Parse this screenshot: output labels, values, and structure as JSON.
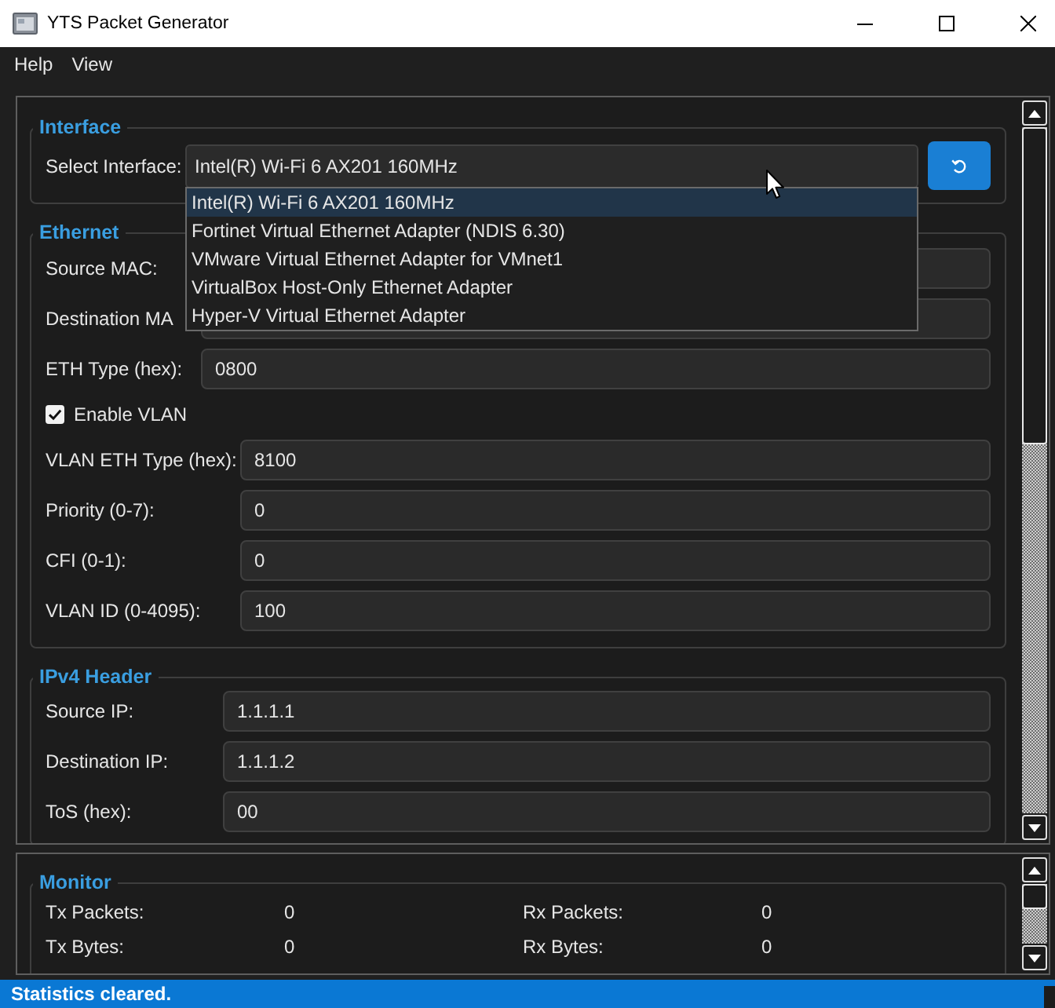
{
  "window": {
    "title": "YTS Packet Generator"
  },
  "menu": [
    {
      "label": "Help"
    },
    {
      "label": "View"
    }
  ],
  "interface": {
    "title": "Interface",
    "label": "Select Interface:",
    "value": "Intel(R) Wi-Fi 6 AX201 160MHz",
    "expanded": true,
    "options": [
      {
        "label": "Intel(R) Wi-Fi 6 AX201 160MHz",
        "selected": true
      },
      {
        "label": "Fortinet Virtual Ethernet Adapter (NDIS 6.30)",
        "selected": false
      },
      {
        "label": "VMware Virtual Ethernet Adapter for VMnet1",
        "selected": false
      },
      {
        "label": "VirtualBox Host-Only Ethernet Adapter",
        "selected": false
      },
      {
        "label": "Hyper-V Virtual Ethernet Adapter",
        "selected": false
      }
    ]
  },
  "ethernet": {
    "title": "Ethernet",
    "fields": [
      {
        "label": "Source MAC:"
      },
      {
        "label": "Destination MA"
      },
      {
        "label": "ETH Type (hex):",
        "value": "0800"
      }
    ],
    "vlan_toggle": {
      "label": "Enable VLAN",
      "checked": true
    },
    "vlan_fields": [
      {
        "label": "VLAN ETH Type (hex):",
        "value": "8100"
      },
      {
        "label": "Priority (0-7):",
        "value": "0"
      },
      {
        "label": "CFI (0-1):",
        "value": "0"
      },
      {
        "label": "VLAN ID (0-4095):",
        "value": "100"
      }
    ]
  },
  "ipv4": {
    "title": "IPv4 Header",
    "fields": [
      {
        "label": "Source IP:",
        "value": "1.1.1.1"
      },
      {
        "label": "Destination IP:",
        "value": "1.1.1.2"
      },
      {
        "label": "ToS (hex):",
        "value": "00"
      }
    ]
  },
  "monitor": {
    "title": "Monitor",
    "stats": [
      {
        "label": "Tx Packets:",
        "value": "0"
      },
      {
        "label": "Rx Packets:",
        "value": "0"
      },
      {
        "label": "Tx Bytes:",
        "value": "0"
      },
      {
        "label": "Rx Bytes:",
        "value": "0"
      }
    ]
  },
  "status_bar": {
    "message": "Statistics cleared."
  }
}
